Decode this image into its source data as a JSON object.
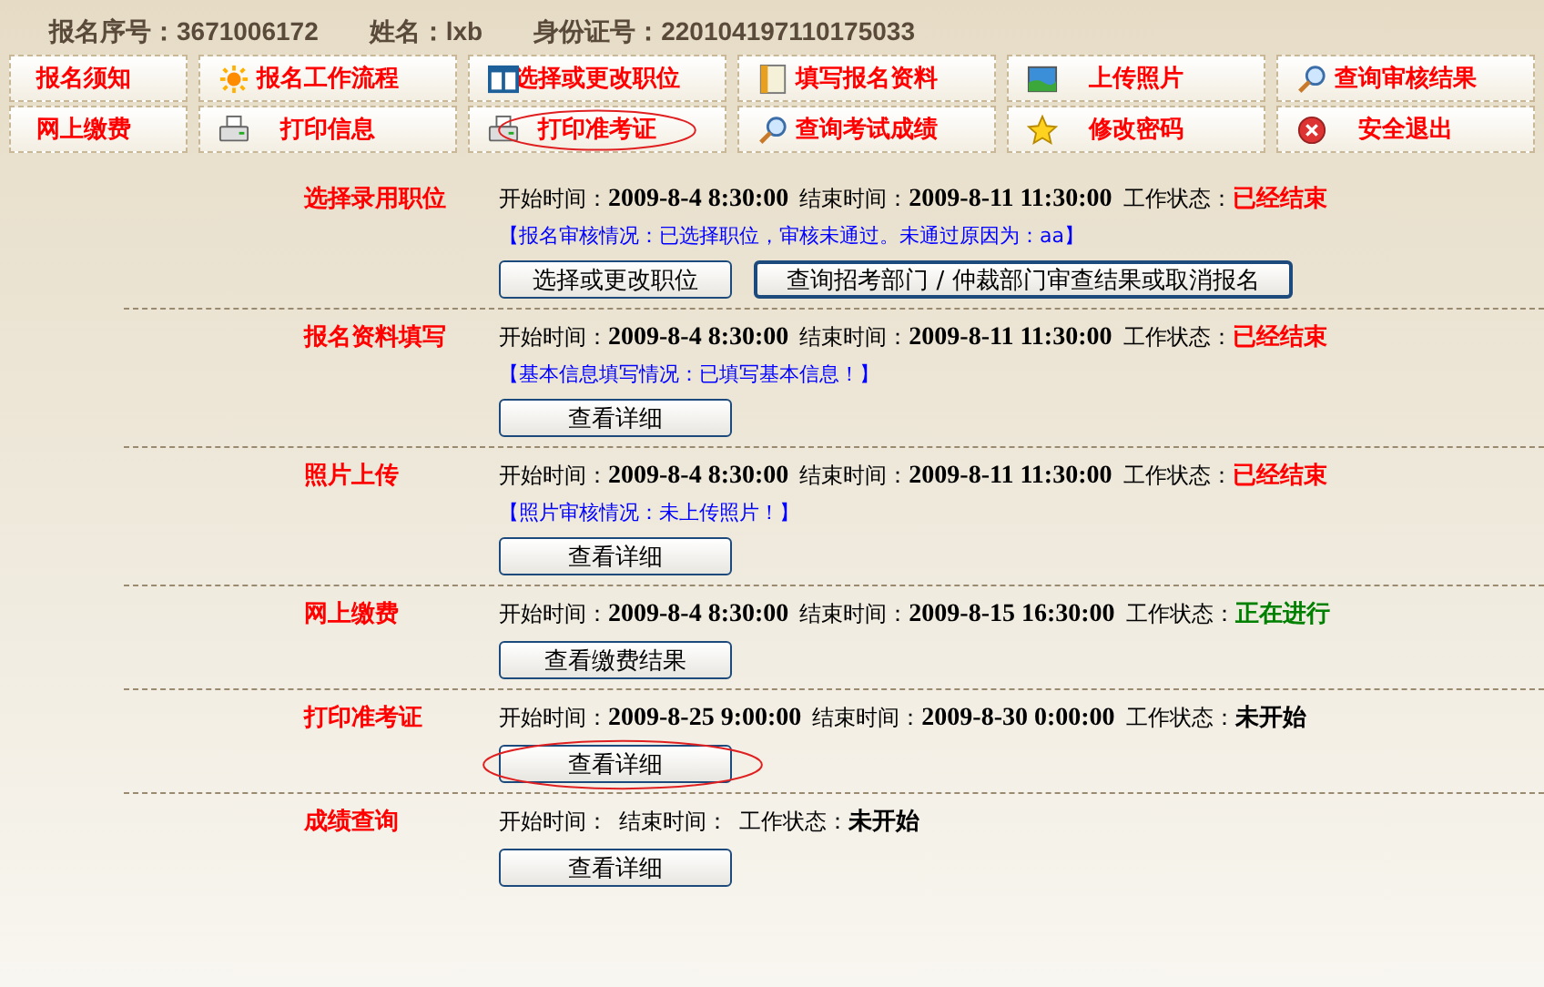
{
  "header": [
    {
      "label": "报名序号：",
      "value": "3671006172"
    },
    {
      "label": "姓名：",
      "value": "lxb"
    },
    {
      "label": "身份证号：",
      "value": "220104197110175033"
    }
  ],
  "nav": [
    {
      "label": "报名须知",
      "kind": "plain",
      "circled": false
    },
    {
      "label": "报名工作流程",
      "kind": "sun",
      "circled": false
    },
    {
      "label": "选择或更改职位",
      "kind": "window",
      "circled": false
    },
    {
      "label": "填写报名资料",
      "kind": "book",
      "circled": false
    },
    {
      "label": "上传照片",
      "kind": "landscape",
      "circled": false
    },
    {
      "label": "查询审核结果",
      "kind": "magnifier",
      "circled": false
    },
    {
      "label": "网上缴费",
      "kind": "plain",
      "circled": false
    },
    {
      "label": "打印信息",
      "kind": "printer",
      "circled": false
    },
    {
      "label": "打印准考证",
      "kind": "printer",
      "circled": true
    },
    {
      "label": "查询考试成绩",
      "kind": "magnifier",
      "circled": false
    },
    {
      "label": "修改密码",
      "kind": "star",
      "circled": false
    },
    {
      "label": "安全退出",
      "kind": "stop",
      "circled": false
    }
  ],
  "steps": [
    {
      "title": "选择录用职位",
      "start": "开始时间：**2009-8-4 8:30:00**",
      "end": "结束时间：**2009-8-11 11:30:00**",
      "status_label": "工作状态：",
      "status": "已经结束",
      "color": "#ff0000",
      "note": "【报名审核情况：已选择职位，审核未通过。未通过原因为：aa】",
      "buttons": [
        {
          "label": "选择或更改职位",
          "circled": false
        },
        {
          "label": "查询招考部门 / 仲裁部门审查结果或取消报名",
          "circled": false
        }
      ]
    },
    {
      "title": "报名资料填写",
      "start": "开始时间：**2009-8-4 8:30:00**",
      "end": "结束时间：**2009-8-11 11:30:00**",
      "status_label": "工作状态：",
      "status": "已经结束",
      "color": "#ff0000",
      "note": "【基本信息填写情况：已填写基本信息！】",
      "buttons": [
        {
          "label": "查看详细",
          "circled": false
        }
      ]
    },
    {
      "title": "照片上传",
      "start": "开始时间：**2009-8-4 8:30:00**",
      "end": "结束时间：**2009-8-11 11:30:00**",
      "status_label": "工作状态：",
      "status": "已经结束",
      "color": "#ff0000",
      "note": "【照片审核情况：未上传照片！】",
      "buttons": [
        {
          "label": "查看详细",
          "circled": false
        }
      ]
    },
    {
      "title": "网上缴费",
      "start": "开始时间：**2009-8-4 8:30:00**",
      "end": "结束时间：**2009-8-15 16:30:00**",
      "status_label": "工作状态：",
      "status": "正在进行",
      "color": "#008000",
      "buttons": [
        {
          "label": "查看缴费结果",
          "circled": false
        }
      ]
    },
    {
      "title": "打印准考证",
      "start": "开始时间：**2009-8-25 9:00:00**",
      "end": "结束时间：**2009-8-30 0:00:00**",
      "status_label": "工作状态：",
      "status": "未开始",
      "color": "#000000",
      "buttons": [
        {
          "label": "查看详细",
          "circled": true
        }
      ]
    },
    {
      "title": "成绩查询",
      "start": "开始时间：",
      "end": "结束时间：",
      "status_label": "工作状态：",
      "status": "未开始",
      "color": "#000000",
      "buttons": [
        {
          "label": "查看详细",
          "circled": false
        }
      ]
    }
  ]
}
